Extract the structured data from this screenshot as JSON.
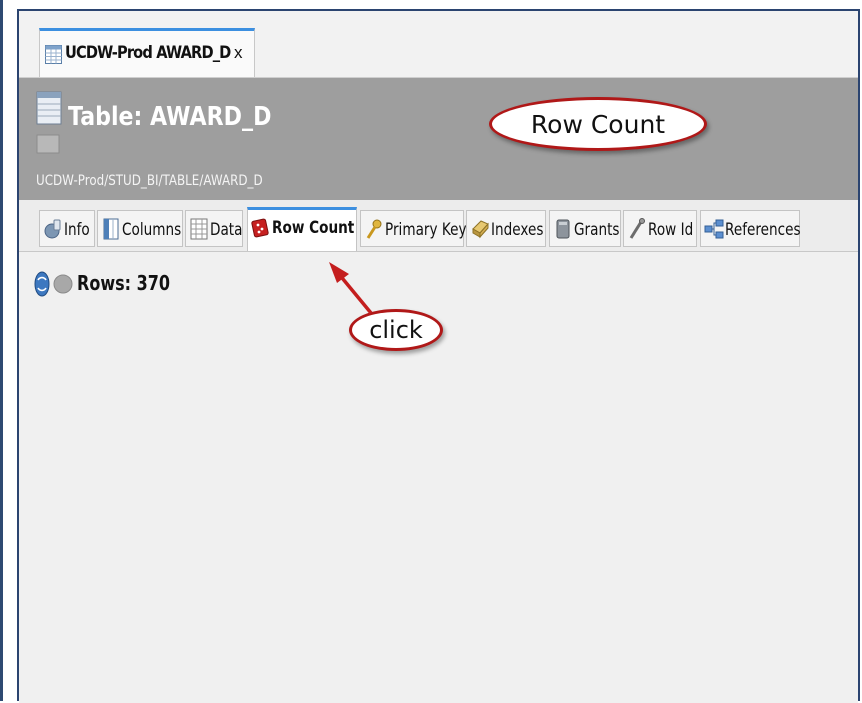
{
  "document_tab": {
    "label": "UCDW-Prod AWARD_D",
    "close": "x"
  },
  "header": {
    "title": "Table: AWARD_D",
    "path": "UCDW-Prod/STUD_BI/TABLE/AWARD_D"
  },
  "callouts": {
    "row_count": "Row Count",
    "click": "click"
  },
  "subtabs": [
    {
      "label": "Info",
      "icon": "info-icon"
    },
    {
      "label": "Columns",
      "icon": "columns-icon"
    },
    {
      "label": "Data",
      "icon": "grid-icon"
    },
    {
      "label": "Row Count",
      "icon": "dice-icon",
      "active": true
    },
    {
      "label": "Primary Key",
      "icon": "key-icon"
    },
    {
      "label": "Indexes",
      "icon": "index-icon"
    },
    {
      "label": "Grants",
      "icon": "grants-icon"
    },
    {
      "label": "Row Id",
      "icon": "pin-icon"
    },
    {
      "label": "References",
      "icon": "references-icon"
    }
  ],
  "content": {
    "rows_label": "Rows: 370"
  },
  "colors": {
    "accent": "#3c8fe0",
    "header_bg": "#9e9e9e",
    "callout_border": "#b01818",
    "arrow": "#c41e1e"
  }
}
